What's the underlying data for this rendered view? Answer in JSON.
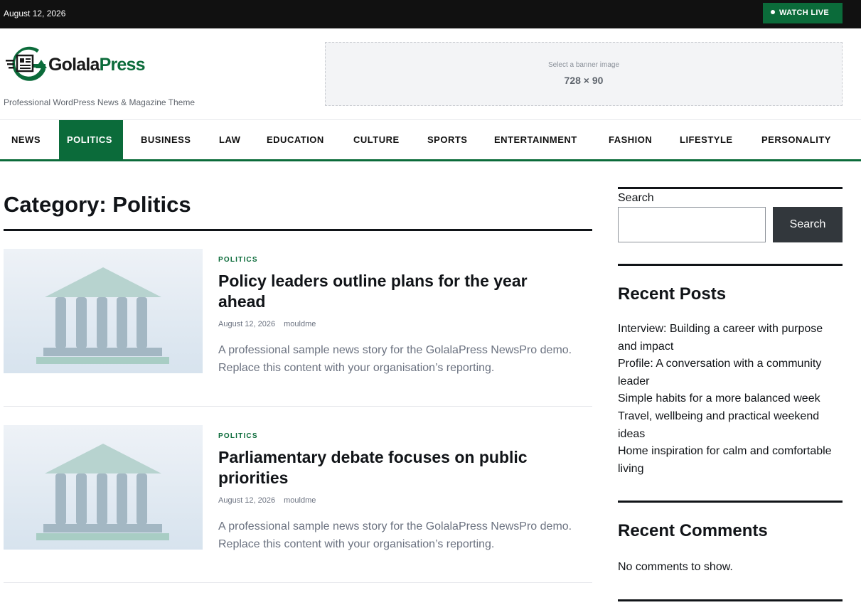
{
  "topbar": {
    "date": "August 12, 2026",
    "watch_live": "WATCH LIVE"
  },
  "header": {
    "logo_part1": "Golala",
    "logo_part2": "Press",
    "tagline": "Professional WordPress News & Magazine Theme",
    "banner_hint": "Select a banner image",
    "banner_size": "728 × 90"
  },
  "nav": {
    "items": [
      {
        "label": "NEWS"
      },
      {
        "label": "POLITICS"
      },
      {
        "label": "BUSINESS"
      },
      {
        "label": "LAW"
      },
      {
        "label": "EDUCATION"
      },
      {
        "label": "CULTURE"
      },
      {
        "label": "SPORTS"
      },
      {
        "label": "ENTERTAINMENT"
      },
      {
        "label": "FASHION"
      },
      {
        "label": "LIFESTYLE"
      },
      {
        "label": "PERSONALITY"
      }
    ],
    "active": "POLITICS"
  },
  "main": {
    "category_title": "Category: Politics",
    "posts": [
      {
        "category": "POLITICS",
        "title": "Policy leaders outline plans for the year ahead",
        "date": "August 12, 2026",
        "author": "mouldme",
        "excerpt": "A professional sample news story for the GolalaPress NewsPro demo. Replace this content with your organisation’s reporting.",
        "thumb_icon": "government-building-icon"
      },
      {
        "category": "POLITICS",
        "title": "Parliamentary debate focuses on public priorities",
        "date": "August 12, 2026",
        "author": "mouldme",
        "excerpt": "A professional sample news story for the GolalaPress NewsPro demo. Replace this content with your organisation’s reporting.",
        "thumb_icon": "government-building-icon"
      }
    ]
  },
  "sidebar": {
    "search": {
      "label": "Search",
      "placeholder": "",
      "button": "Search"
    },
    "recent_posts": {
      "title": "Recent Posts",
      "items": [
        "Interview: Building a career with purpose and impact",
        "Profile: A conversation with a community leader",
        "Simple habits for a more balanced week",
        "Travel, wellbeing and practical weekend ideas",
        "Home inspiration for calm and comfortable living"
      ]
    },
    "recent_comments": {
      "title": "Recent Comments",
      "empty": "No comments to show."
    }
  },
  "colors": {
    "brand": "#0b6b3a",
    "topbar": "#111111",
    "button_dark": "#32373c"
  }
}
